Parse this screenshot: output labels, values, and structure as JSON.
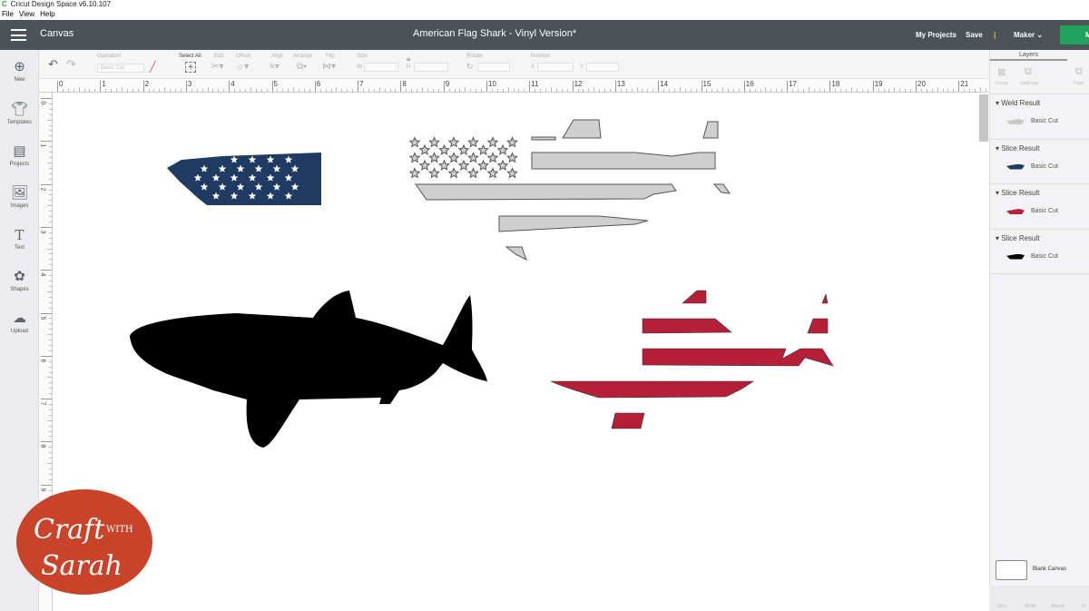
{
  "window": {
    "title": "Cricut Design Space  v6.10.107",
    "menu": [
      "File",
      "View",
      "Help"
    ]
  },
  "header": {
    "section": "Canvas",
    "document_title": "American Flag Shark - Vinyl Version*",
    "my_projects": "My Projects",
    "save": "Save",
    "separator": "|",
    "machine": "Maker",
    "make_it": "M"
  },
  "toolbar": {
    "operation_label": "Operation",
    "operation_value": "Basic Cut",
    "select_all": "Select All",
    "edit": "Edit",
    "offset": "Offset",
    "align": "Align",
    "arrange": "Arrange",
    "flip": "Flip",
    "size": "Size",
    "w": "W",
    "h": "H",
    "rotate": "Rotate",
    "position": "Position",
    "x": "X",
    "y": "Y"
  },
  "sidebar": [
    {
      "label": "New",
      "icon": "plus-circle-icon"
    },
    {
      "label": "Templates",
      "icon": "shirt-icon"
    },
    {
      "label": "Projects",
      "icon": "notebook-icon"
    },
    {
      "label": "Images",
      "icon": "image-icon"
    },
    {
      "label": "Text",
      "icon": "text-icon"
    },
    {
      "label": "Shapes",
      "icon": "shapes-icon"
    },
    {
      "label": "Upload",
      "icon": "upload-cloud-icon"
    }
  ],
  "ruler": {
    "h": [
      "0",
      "1",
      "2",
      "3",
      "4",
      "5",
      "6",
      "7",
      "8",
      "9",
      "10",
      "11",
      "12",
      "13",
      "14",
      "15",
      "16",
      "17",
      "18",
      "19",
      "20",
      "21"
    ],
    "v": [
      "0",
      "1",
      "2",
      "3",
      "4",
      "5",
      "6",
      "7",
      "8",
      "9"
    ]
  },
  "layers": {
    "title": "Layers",
    "tools": [
      "Group",
      "UnGroup",
      "Dupli"
    ],
    "groups": [
      {
        "name": "Weld Result",
        "item": "Basic Cut",
        "color": "#c8c8c8"
      },
      {
        "name": "Slice Result",
        "item": "Basic Cut",
        "color": "#1f3a63"
      },
      {
        "name": "Slice Result",
        "item": "Basic Cut",
        "color": "#b51f38"
      },
      {
        "name": "Slice Result",
        "item": "Basic Cut",
        "color": "#000000"
      }
    ],
    "blank_canvas": "Blank Canvas",
    "bottom_tools": [
      "Slice",
      "Weld",
      "Attach",
      "Fl"
    ]
  },
  "logo": {
    "line1": "Craft",
    "with": "WITH",
    "line2": "Sarah",
    "color": "#c8432a"
  }
}
